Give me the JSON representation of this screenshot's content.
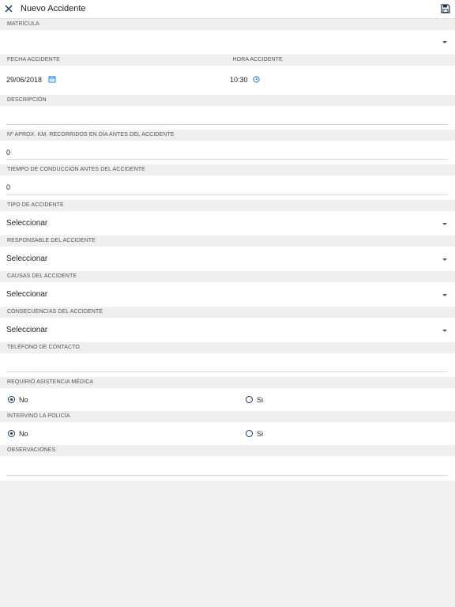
{
  "header": {
    "title": "Nuevo Accidente"
  },
  "fields": {
    "matricula": {
      "label": "MATRÍCULA",
      "value": ""
    },
    "fecha": {
      "label": "FECHA ACCIDENTE",
      "value": "29/06/2018"
    },
    "hora": {
      "label": "HORA ACCIDENTE",
      "value": "10:30"
    },
    "descripcion": {
      "label": "DESCRIPCIÓN",
      "value": ""
    },
    "km": {
      "label": "Nº APROX. KM. RECORRIDOS EN DÍA ANTES DEL ACCIDENTE",
      "value": "0"
    },
    "tiempo": {
      "label": "TIEMPO DE CONDUCCIÓN ANTES DEL ACCIDENTE",
      "value": "0"
    },
    "tipo": {
      "label": "TIPO DE ACCIDENTE",
      "value": "Seleccionar"
    },
    "responsable": {
      "label": "RESPONSABLE DEL ACCIDENTE",
      "value": "Seleccionar"
    },
    "causas": {
      "label": "CAUSAS DEL ACCIDENTE",
      "value": "Seleccionar"
    },
    "consecuencias": {
      "label": "CONSECUENCIAS DEL ACCIDENTE",
      "value": "Seleccionar"
    },
    "telefono": {
      "label": "TELÉFONO DE CONTACTO",
      "value": ""
    },
    "asistencia": {
      "label": "REQUIRIÓ ASISTENCIA MÉDICA",
      "option_no": "No",
      "option_si": "Si",
      "selected": "No"
    },
    "policia": {
      "label": "INTERVINO LA POLICÍA",
      "option_no": "No",
      "option_si": "Si",
      "selected": "No"
    },
    "observaciones": {
      "label": "OBSERVACIONES",
      "value": ""
    }
  },
  "colors": {
    "accent": "#1e88e5",
    "radio": "#1d3557"
  },
  "icons": {
    "close": "close-icon",
    "save": "save-icon",
    "calendar": "calendar-icon",
    "clock": "clock-icon"
  }
}
